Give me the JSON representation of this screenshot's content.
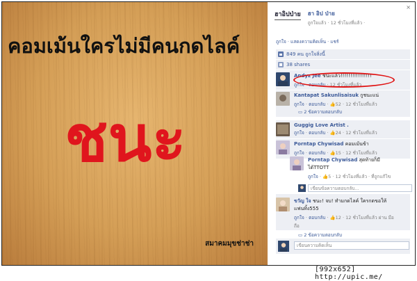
{
  "meme": {
    "top_text": "คอมเม้นใครไม่มีคนกดไลค์",
    "big_text": "ชนะ",
    "credit": "สมาคมมุขช่าช่า"
  },
  "panel": {
    "close": "×",
    "logo": "ฮาอิปป่าย",
    "poster_name": "ฮา อิป ป่าย",
    "poster_meta": "ถูกใจแล้ว · 12 ชั่วโมงที่แล้ว ·",
    "actions": "ถูกใจ · แสดงความคิดเห็น · แชร์",
    "likes": "849 คน ถูกใจสิ่งนี้",
    "shares": "38 shares"
  },
  "comments": [
    {
      "name": "Andyz Jee",
      "text": "ชนะแล้ว!!!!!!!!!!!!!!!!",
      "meta_like": "ถูกใจ",
      "meta_reply": "ตอบกลับ",
      "meta_time": "· 12 ชั่วโมงที่แล้ว"
    },
    {
      "name": "Kantapat Sakunlisaisuk",
      "text": "กูชนะแน่",
      "meta_like": "ถูกใจ",
      "meta_reply": "ตอบกลับ",
      "meta_count": "52",
      "meta_time": "· 12 ชั่วโมงที่แล้ว",
      "replies": "2 ข้อความตอบกลับ"
    },
    {
      "name": "Guggig Love Artist .",
      "text": "",
      "meta_like": "ถูกใจ",
      "meta_reply": "ตอบกลับ",
      "meta_count": "24",
      "meta_time": "· 12 ชั่วโมงที่แล้ว"
    },
    {
      "name": "Porntap Chywisad",
      "text": "คอมเม้นข้า",
      "meta_like": "ถูกใจ",
      "meta_reply": "ตอบกลับ",
      "meta_count": "15",
      "meta_time": "· 12 ชั่วโมงที่แล้ว"
    },
    {
      "name": "Porntap Chywisad",
      "text": "สุดท้ายก็มี",
      "text2": "ได้TTOTT",
      "meta_like": "ถูกใจ",
      "meta_count": "5",
      "meta_time": "· 12 ชั่วโมงที่แล้ว · ที่ถูกแก้ไข"
    },
    {
      "name": "ขวัญ ใจ",
      "text": "ชนะ! จบ! ทำมกดไลค์ ใครกดขอให้",
      "text2": "แฟนทิ้ง555",
      "meta_like": "ถูกใจ",
      "meta_reply": "ตอบกลับ",
      "meta_count": "12",
      "meta_time": "· 12 ชั่วโมงที่แล้ว ผ่าน มือ",
      "meta_tail": "ถือ",
      "replies": "2 ข้อความตอบกลับ"
    }
  ],
  "reply_placeholder": "เขียนข้อความตอบกลับ...",
  "comment_placeholder": "เขียนความคิดเห็น",
  "footer": "[992x652]  http://upic.me/",
  "colors": {
    "fb_blue": "#3b5998",
    "meme_red": "#e0151d",
    "highlight_oval": "#e01010"
  }
}
